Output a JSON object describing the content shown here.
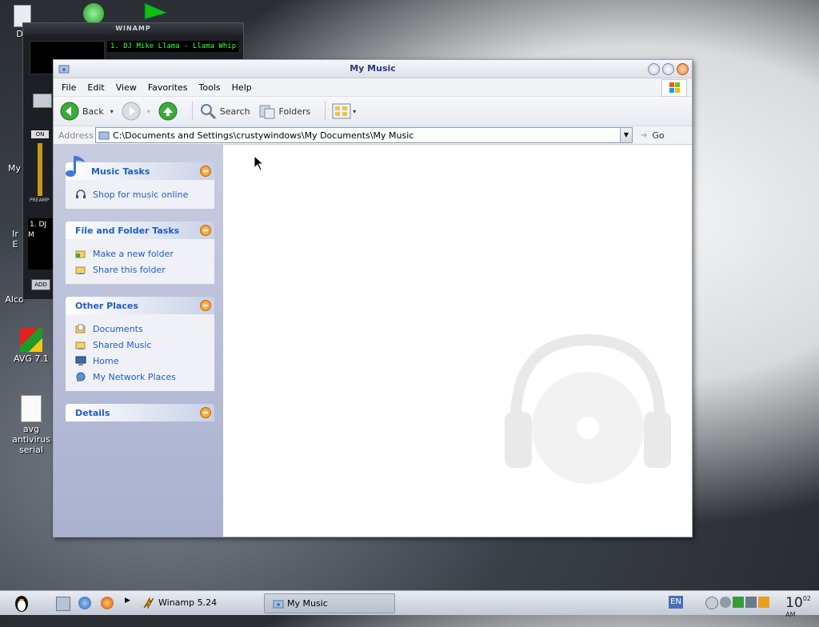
{
  "desktop": {
    "icons": [
      {
        "label": "Do"
      },
      {
        "label": "My"
      },
      {
        "label": "Ir E"
      },
      {
        "label": "Alco"
      },
      {
        "label": "AVG 7.1"
      },
      {
        "label": "avg antivirus serial"
      }
    ]
  },
  "winamp": {
    "title": "WINAMP",
    "track": "1. DJ Mike Llama - Llama Whip",
    "playlist_item": "1. DJ M",
    "on_label": "ON",
    "preamp_label": "PREAMP",
    "add_label": "ADD"
  },
  "window": {
    "title": "My Music",
    "menu": [
      "File",
      "Edit",
      "View",
      "Favorites",
      "Tools",
      "Help"
    ],
    "toolbar": {
      "back": "Back",
      "search": "Search",
      "folders": "Folders"
    },
    "address": {
      "label": "Address",
      "value": "C:\\Documents and Settings\\crustywindows\\My Documents\\My Music",
      "go": "Go"
    },
    "tasks": {
      "music": {
        "title": "Music Tasks",
        "items": [
          "Shop for music online"
        ]
      },
      "file_folder": {
        "title": "File and Folder Tasks",
        "items": [
          "Make a new folder",
          "Share this folder"
        ]
      },
      "other_places": {
        "title": "Other Places",
        "items": [
          "Documents",
          "Shared Music",
          "Home",
          "My Network Places"
        ]
      },
      "details": {
        "title": "Details"
      }
    }
  },
  "taskbar": {
    "tasks": [
      {
        "label": "Winamp 5.24"
      },
      {
        "label": "My Music"
      }
    ],
    "language": "EN",
    "clock_hour": "10",
    "clock_min": "02",
    "clock_ampm": "AM"
  },
  "colors": {
    "link": "#215dc6",
    "collapse_orange": "#ee8a14"
  }
}
